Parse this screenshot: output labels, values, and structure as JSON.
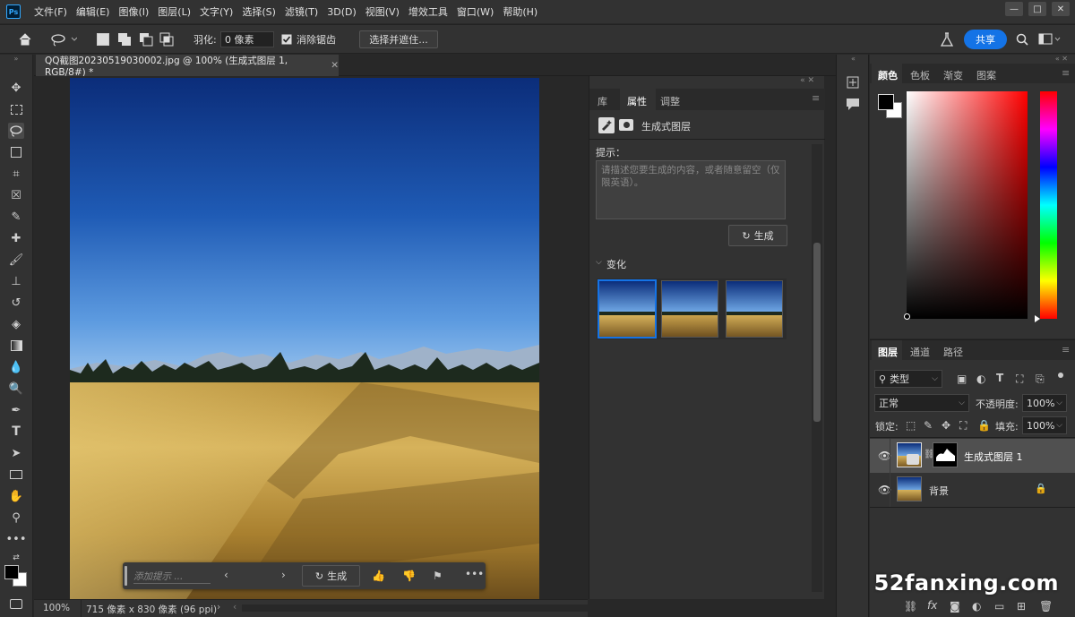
{
  "app": {
    "logo_text": "Ps"
  },
  "menu": [
    "文件(F)",
    "编辑(E)",
    "图像(I)",
    "图层(L)",
    "文字(Y)",
    "选择(S)",
    "滤镜(T)",
    "3D(D)",
    "视图(V)",
    "增效工具",
    "窗口(W)",
    "帮助(H)"
  ],
  "window_controls": {
    "minimize": "—",
    "maximize": "□",
    "close": "✕"
  },
  "options": {
    "feather_label": "羽化:",
    "feather_value": "0 像素",
    "antialias_label": "消除锯齿",
    "select_mask_label": "选择并遮住...",
    "share_label": "共享"
  },
  "document": {
    "tab_title": "QQ截图20230519030002.jpg @ 100% (生成式图层 1, RGB/8#) *",
    "zoom": "100%",
    "size_info": "715 像素 x 830 像素 (96 ppi)"
  },
  "contextual_taskbar": {
    "prompt_placeholder": "添加提示 ...",
    "generate_label": "生成"
  },
  "properties": {
    "tabs": [
      "库",
      "属性",
      "调整"
    ],
    "layer_type": "生成式图层",
    "prompt_label": "提示：",
    "prompt_placeholder": "请描述您要生成的内容，或者随意留空（仅限英语）。",
    "generate_label": "生成",
    "variations_label": "变化"
  },
  "color_panel": {
    "tabs": [
      "颜色",
      "色板",
      "渐变",
      "图案"
    ],
    "foreground": "#000000",
    "background": "#ffffff",
    "hue_color": "#ff0000"
  },
  "layers_panel": {
    "tabs": [
      "图层",
      "通道",
      "路径"
    ],
    "filter_label": "类型",
    "blend_mode": "正常",
    "opacity_label": "不透明度:",
    "opacity_value": "100%",
    "lock_label": "锁定:",
    "fill_label": "填充:",
    "fill_value": "100%",
    "layers": [
      {
        "name": "生成式图层 1",
        "selected": true
      },
      {
        "name": "背景",
        "locked": true
      }
    ]
  },
  "watermark": "52fanxing.com"
}
